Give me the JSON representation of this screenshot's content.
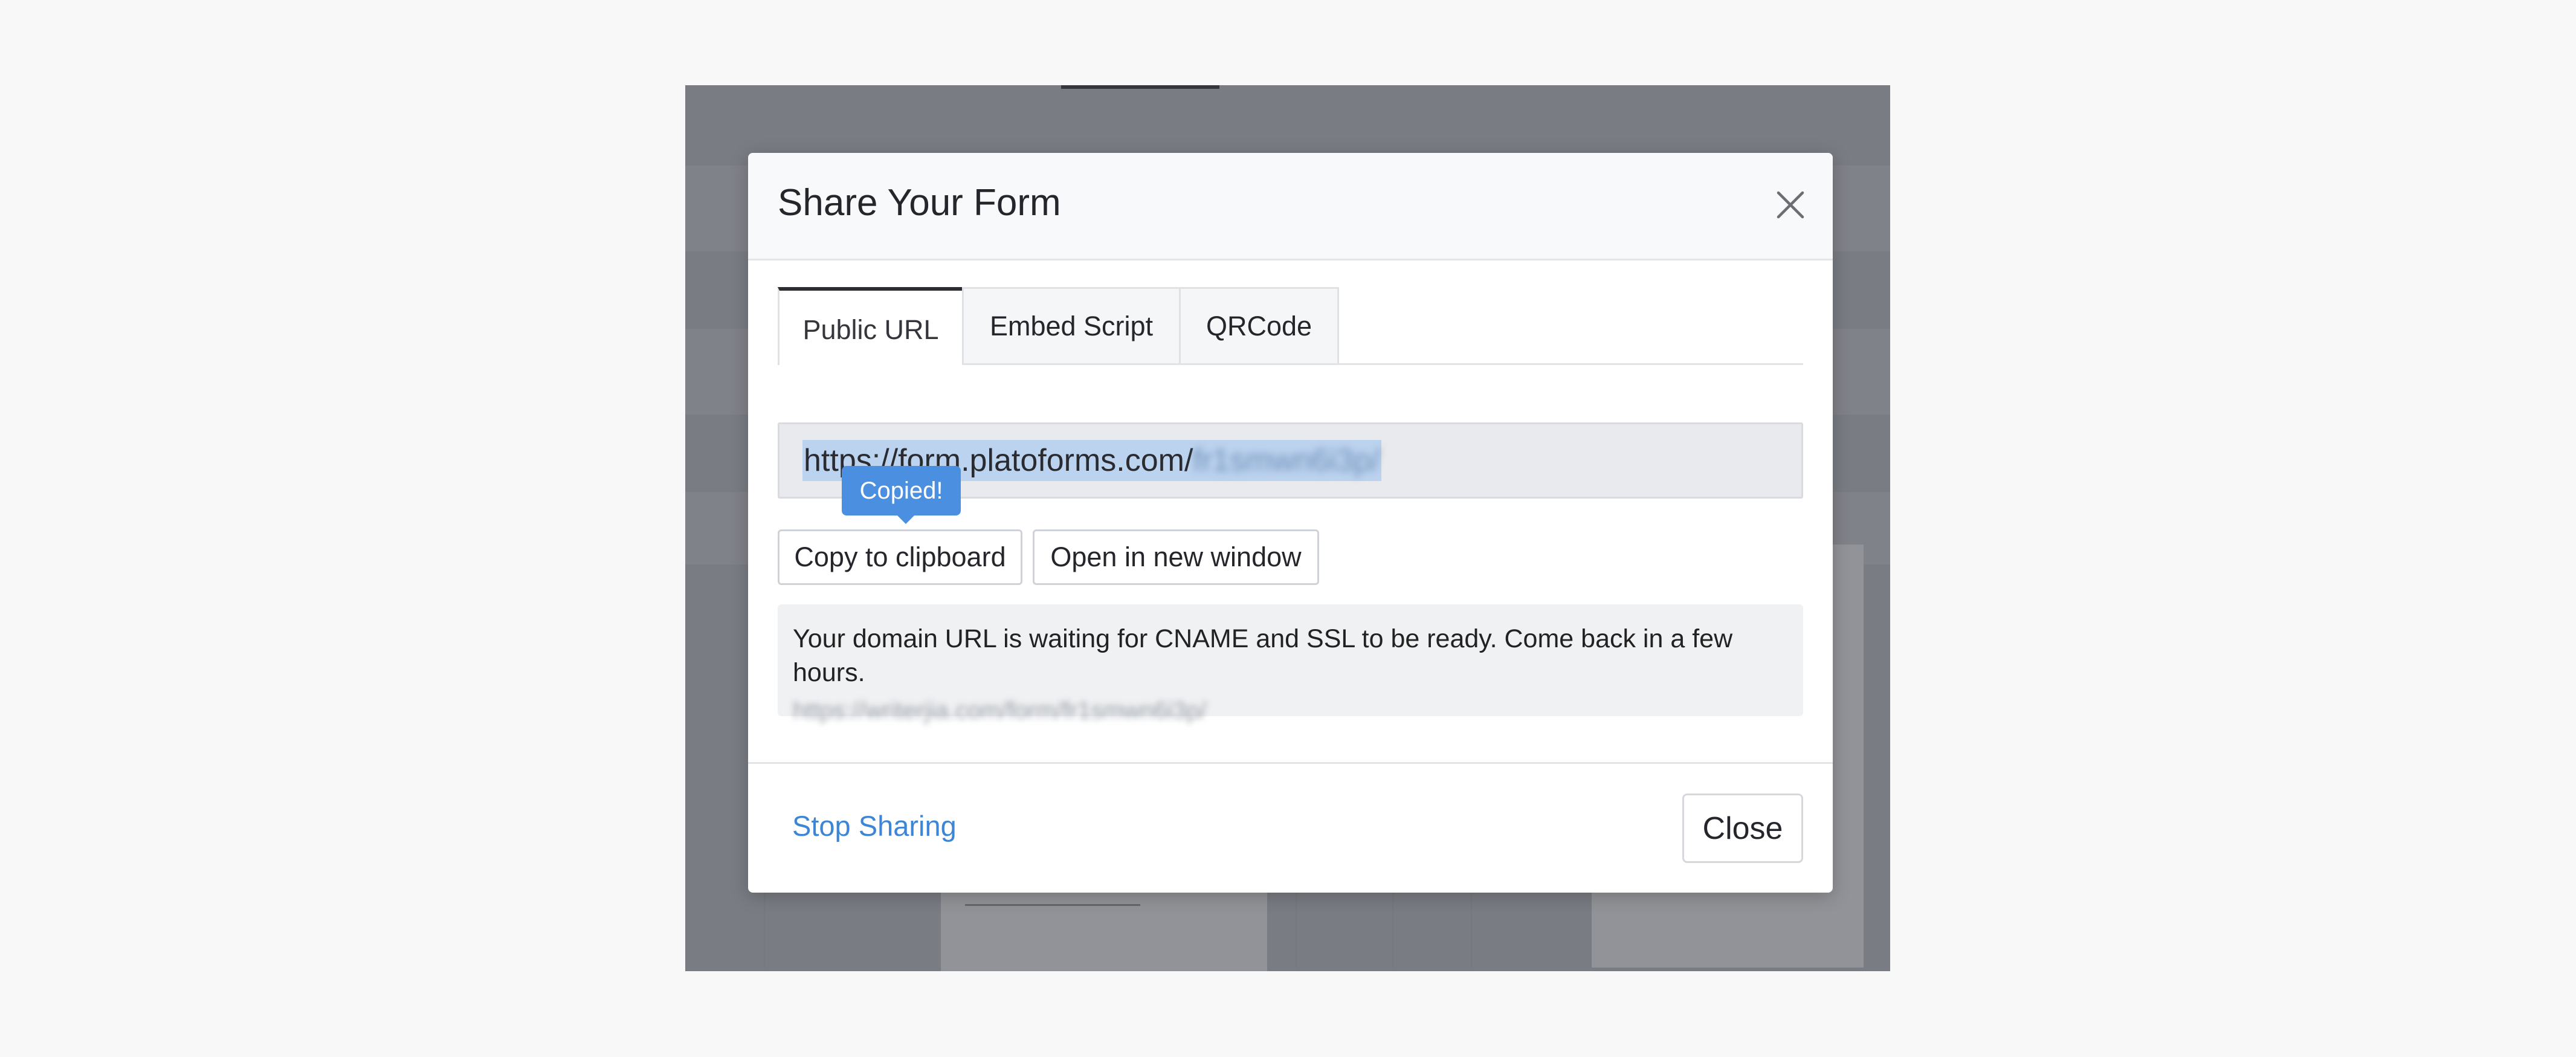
{
  "modal": {
    "title": "Share Your Form",
    "close_icon": "close-icon"
  },
  "tabs": [
    {
      "label": "Public URL",
      "active": true
    },
    {
      "label": "Embed Script",
      "active": false
    },
    {
      "label": "QRCode",
      "active": false
    }
  ],
  "url": {
    "visible_prefix": "https://form.platoforms.com/",
    "blurred_suffix": "fr1smwn6i3p/"
  },
  "tooltip": {
    "text": "Copied!"
  },
  "buttons": {
    "copy_label": "Copy to clipboard",
    "open_label": "Open in new window"
  },
  "notice": {
    "text": "Your domain URL is waiting for CNAME and SSL to be ready. Come back in a few hours.",
    "url": "https://writerjia.com/form/fr1smwn6i3p/"
  },
  "footer": {
    "stop_sharing_label": "Stop Sharing",
    "close_label": "Close"
  },
  "colors": {
    "accent": "#4b8fe0",
    "link": "#3d86d6",
    "selection": "#bcd3ef"
  }
}
